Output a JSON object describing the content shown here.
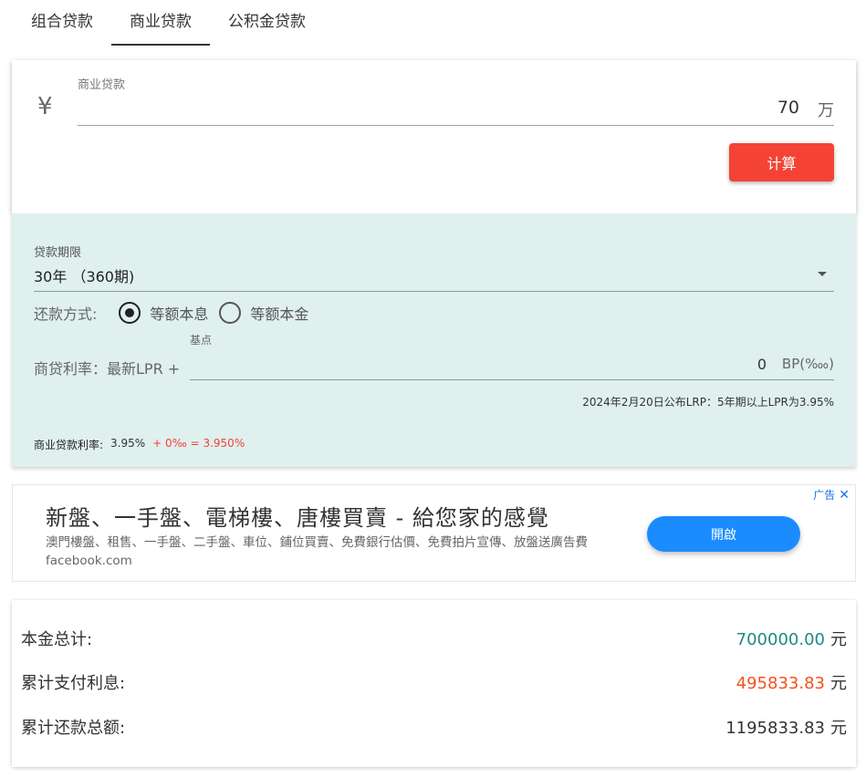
{
  "tabs": [
    {
      "label": "组合贷款",
      "active": false
    },
    {
      "label": "商业贷款",
      "active": true
    },
    {
      "label": "公积金贷款",
      "active": false
    }
  ],
  "amount": {
    "currency_symbol": "¥",
    "label": "商业贷款",
    "value": "70",
    "unit": "万",
    "calc_button": "计算"
  },
  "options": {
    "term_label": "贷款期限",
    "term_value": "30年 （360期)",
    "repay_label": "还款方式:",
    "repay_methods": [
      {
        "label": "等额本息",
        "checked": true
      },
      {
        "label": "等额本金",
        "checked": false
      }
    ],
    "bp_caption": "基点",
    "rate_label": "商贷利率：最新LPR +",
    "bp_value": "0",
    "bp_unit": "BP(‱)",
    "lpr_note": "2024年2月20日公布LRP：5年期以上LPR为3.95%",
    "rate_summary": {
      "label": "商业贷款利率:",
      "base": "3.95%",
      "extra": "+ 0‰ = 3.950%"
    }
  },
  "ad": {
    "title": "新盤、一手盤、電梯樓、唐樓買賣 - 給您家的感覺",
    "description": "澳門樓盤、租售、一手盤、二手盤、車位、鋪位買賣、免費銀行估價、免費拍片宣傳、放盤送廣告費 facebook.com",
    "open_button": "開啟",
    "badge": "广告",
    "close": "✕"
  },
  "results": {
    "principal_label": "本金总计:",
    "principal_value": "700000.00",
    "interest_label": "累计支付利息:",
    "interest_value": "495833.83",
    "total_label": "累计还款总额:",
    "total_value": "1195833.83",
    "unit": "元"
  },
  "colors": {
    "accent_red": "#f44336",
    "options_bg": "#dff0ef",
    "principal": "#1f8a84",
    "interest": "#f4511e",
    "ad_button": "#1a8cff"
  }
}
